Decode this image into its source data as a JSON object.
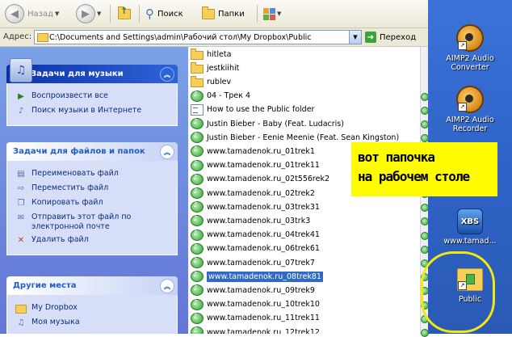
{
  "toolbar": {
    "back_label": "Назад",
    "search_label": "Поиск",
    "folders_label": "Папки"
  },
  "address": {
    "label": "Адрес:",
    "path": "C:\\Documents and Settings\\admin\\Рабочий стол\\My Dropbox\\Public",
    "go_label": "Переход"
  },
  "left_panel": {
    "music_tasks": {
      "title": "Задачи для музыки",
      "items": [
        "Воспроизвести все",
        "Поиск музыки в Интернете"
      ]
    },
    "file_tasks": {
      "title": "Задачи для файлов и папок",
      "items": [
        "Переименовать файл",
        "Переместить файл",
        "Копировать файл",
        "Отправить этот файл по электронной почте",
        "Удалить файл"
      ]
    },
    "other_places": {
      "title": "Другие места",
      "items": [
        "My Dropbox",
        "Моя музыка"
      ]
    }
  },
  "files": [
    {
      "name": "hitleta",
      "type": "folder"
    },
    {
      "name": "jestkiihit",
      "type": "folder"
    },
    {
      "name": "rublev",
      "type": "folder"
    },
    {
      "name": "04 - Трек  4",
      "type": "audio"
    },
    {
      "name": "How to use the Public folder",
      "type": "doc"
    },
    {
      "name": "Justin Bieber - Baby (Feat. Ludacris)",
      "type": "audio"
    },
    {
      "name": "Justin Bieber - Eenie Meenie (Feat. Sean Kingston)",
      "type": "audio"
    },
    {
      "name": "www.tamadenok.ru_01trek1",
      "type": "audio"
    },
    {
      "name": "www.tamadenok.ru_01trek11",
      "type": "audio"
    },
    {
      "name": "www.tamadenok.ru_02t556rek2",
      "type": "audio"
    },
    {
      "name": "www.tamadenok.ru_02trek2",
      "type": "audio"
    },
    {
      "name": "www.tamadenok.ru_03trek31",
      "type": "audio"
    },
    {
      "name": "www.tamadenok.ru_03trk3",
      "type": "audio"
    },
    {
      "name": "www.tamadenok.ru_04trek41",
      "type": "audio"
    },
    {
      "name": "www.tamadenok.ru_06trek61",
      "type": "audio"
    },
    {
      "name": "www.tamadenok.ru_07trek7",
      "type": "audio"
    },
    {
      "name": "www.tamadenok.ru_08trek81",
      "type": "audio",
      "selected": true
    },
    {
      "name": "www.tamadenok.ru_09trek9",
      "type": "audio"
    },
    {
      "name": "www.tamadenok.ru_10trek10",
      "type": "audio"
    },
    {
      "name": "www.tamadenok.ru_11trek11",
      "type": "audio"
    },
    {
      "name": "www.tamadenok.ru_12trek12",
      "type": "audio"
    }
  ],
  "desktop": {
    "icons": [
      {
        "label_line1": "AIMP2 Audio",
        "label_line2": "Converter"
      },
      {
        "label_line1": "AIMP2 Audio",
        "label_line2": "Recorder"
      },
      {
        "label_line1": "www.tamad...",
        "label_line2": ""
      },
      {
        "label_line1": "Public",
        "label_line2": ""
      }
    ],
    "xbs_icon_text": "XBS"
  },
  "annotation": {
    "line1": "вот папочка",
    "line2": "на рабочем столе",
    "color": "#fffb00"
  }
}
